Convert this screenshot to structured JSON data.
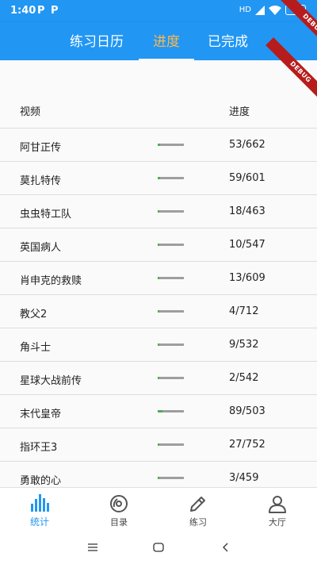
{
  "status_bar": {
    "time": "1:40",
    "app_icon_1": "P",
    "app_icon_2": "P",
    "battery": "25",
    "network": "HD"
  },
  "tabs": [
    {
      "label": "练习日历",
      "active": false
    },
    {
      "label": "进度",
      "active": true
    },
    {
      "label": "已完成",
      "active": false
    }
  ],
  "debug_label": "DEBUG",
  "table": {
    "headers": {
      "video": "视频",
      "progress": "进度"
    },
    "rows": [
      {
        "title": "阿甘正传",
        "count": "53/662",
        "done": 53,
        "total": 662
      },
      {
        "title": "莫扎特传",
        "count": "59/601",
        "done": 59,
        "total": 601
      },
      {
        "title": "虫虫特工队",
        "count": "18/463",
        "done": 18,
        "total": 463
      },
      {
        "title": "英国病人",
        "count": "10/547",
        "done": 10,
        "total": 547
      },
      {
        "title": "肖申克的救赎",
        "count": "13/609",
        "done": 13,
        "total": 609
      },
      {
        "title": "教父2",
        "count": "4/712",
        "done": 4,
        "total": 712
      },
      {
        "title": "角斗士",
        "count": "9/532",
        "done": 9,
        "total": 532
      },
      {
        "title": "星球大战前传",
        "count": "2/542",
        "done": 2,
        "total": 542
      },
      {
        "title": "末代皇帝",
        "count": "89/503",
        "done": 89,
        "total": 503
      },
      {
        "title": "指环王3",
        "count": "27/752",
        "done": 27,
        "total": 752
      },
      {
        "title": "勇敢的心",
        "count": "3/459",
        "done": 3,
        "total": 459
      }
    ]
  },
  "bottom_nav": [
    {
      "label": "统计",
      "icon": "bar-chart-icon",
      "active": true
    },
    {
      "label": "目录",
      "icon": "disc-icon",
      "active": false
    },
    {
      "label": "练习",
      "icon": "pencil-icon",
      "active": false
    },
    {
      "label": "大厅",
      "icon": "person-icon",
      "active": false
    }
  ],
  "colors": {
    "primary": "#2196f3",
    "active_tab": "#ffb74d",
    "progress_fill": "#4caf50",
    "progress_track": "#9e9e9e",
    "debug": "#b71c1c"
  }
}
